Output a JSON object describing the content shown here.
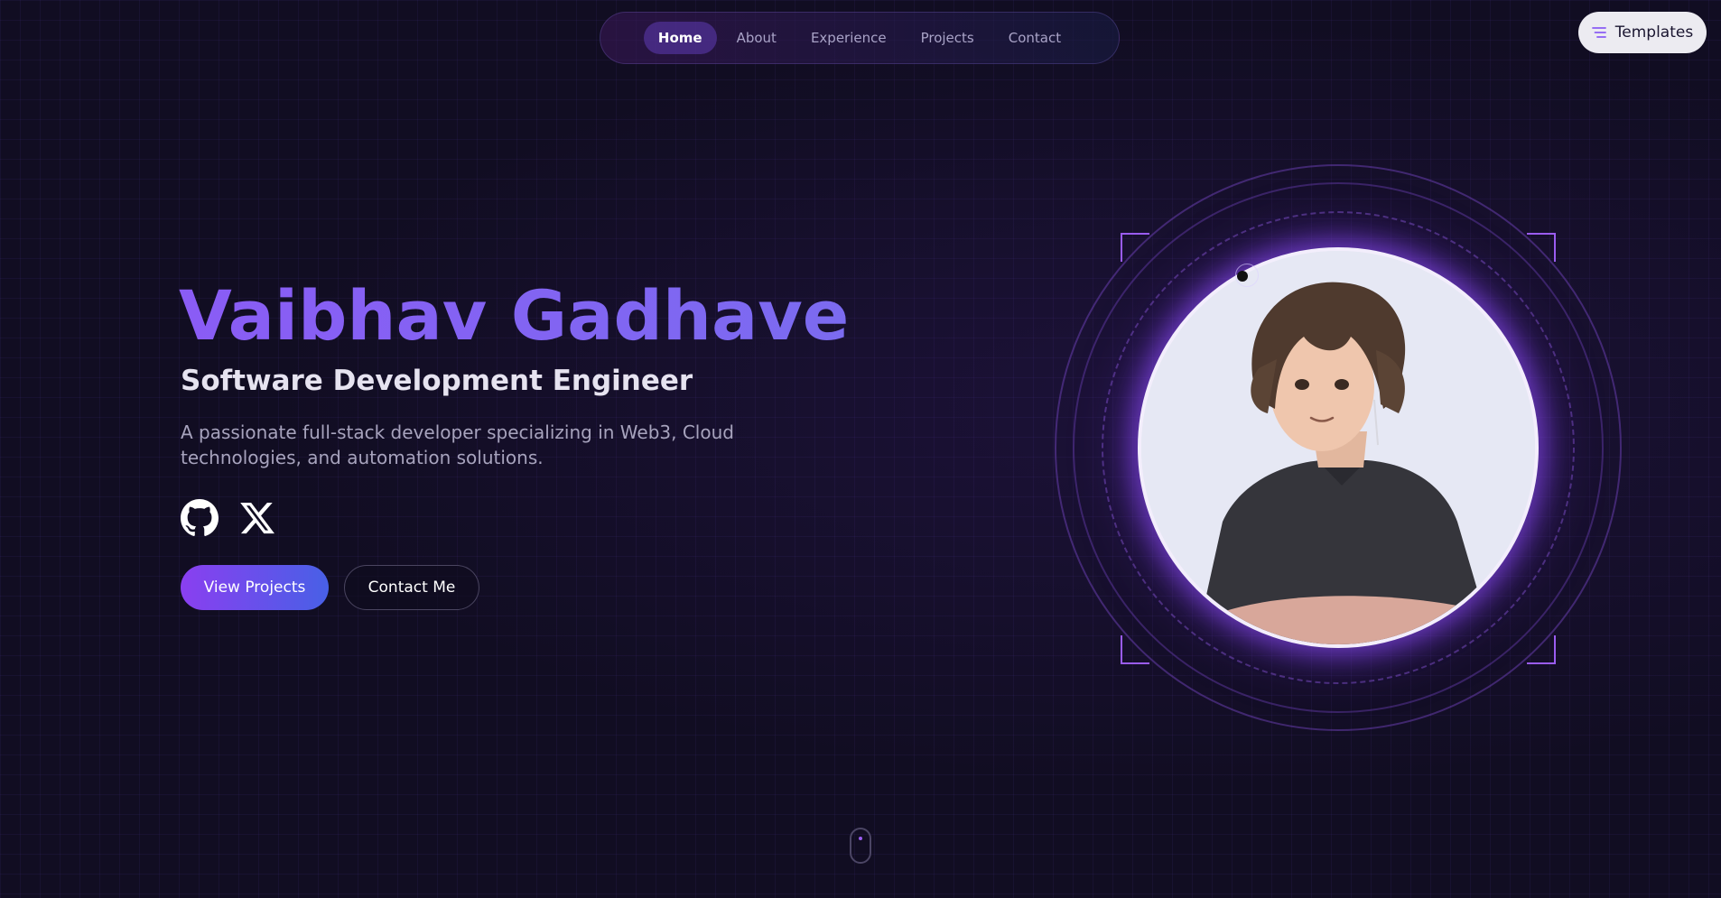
{
  "nav": {
    "items": [
      {
        "label": "Home",
        "active": true
      },
      {
        "label": "About",
        "active": false
      },
      {
        "label": "Experience",
        "active": false
      },
      {
        "label": "Projects",
        "active": false
      },
      {
        "label": "Contact",
        "active": false
      }
    ]
  },
  "templates_button": {
    "label": "Templates",
    "icon": "menu-lines-icon"
  },
  "hero": {
    "name": "Vaibhav Gadhave",
    "role": "Software Development Engineer",
    "description": "A passionate full-stack developer specializing in Web3, Cloud technologies, and automation solutions.",
    "socials": [
      {
        "icon": "github-icon"
      },
      {
        "icon": "x-twitter-icon"
      }
    ],
    "primary_button": "View Projects",
    "secondary_button": "Contact Me"
  },
  "portrait": {
    "icon": "anime-avatar-illustration"
  },
  "colors": {
    "background": "#110d22",
    "accent_purple": "#8a5cf5",
    "button_gradient_start": "#8a3ff0",
    "button_gradient_end": "#4860e6",
    "templates_bg": "#ecebf1"
  }
}
